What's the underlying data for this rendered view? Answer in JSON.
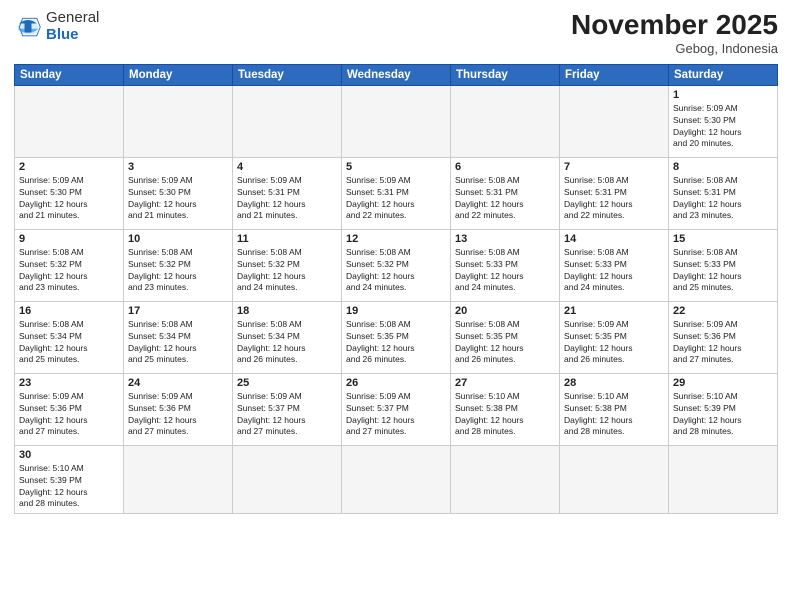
{
  "header": {
    "logo_general": "General",
    "logo_blue": "Blue",
    "month_title": "November 2025",
    "subtitle": "Gebog, Indonesia"
  },
  "weekdays": [
    "Sunday",
    "Monday",
    "Tuesday",
    "Wednesday",
    "Thursday",
    "Friday",
    "Saturday"
  ],
  "weeks": [
    [
      {
        "day": "",
        "info": ""
      },
      {
        "day": "",
        "info": ""
      },
      {
        "day": "",
        "info": ""
      },
      {
        "day": "",
        "info": ""
      },
      {
        "day": "",
        "info": ""
      },
      {
        "day": "",
        "info": ""
      },
      {
        "day": "1",
        "info": "Sunrise: 5:09 AM\nSunset: 5:30 PM\nDaylight: 12 hours\nand 20 minutes."
      }
    ],
    [
      {
        "day": "2",
        "info": "Sunrise: 5:09 AM\nSunset: 5:30 PM\nDaylight: 12 hours\nand 21 minutes."
      },
      {
        "day": "3",
        "info": "Sunrise: 5:09 AM\nSunset: 5:30 PM\nDaylight: 12 hours\nand 21 minutes."
      },
      {
        "day": "4",
        "info": "Sunrise: 5:09 AM\nSunset: 5:31 PM\nDaylight: 12 hours\nand 21 minutes."
      },
      {
        "day": "5",
        "info": "Sunrise: 5:09 AM\nSunset: 5:31 PM\nDaylight: 12 hours\nand 22 minutes."
      },
      {
        "day": "6",
        "info": "Sunrise: 5:08 AM\nSunset: 5:31 PM\nDaylight: 12 hours\nand 22 minutes."
      },
      {
        "day": "7",
        "info": "Sunrise: 5:08 AM\nSunset: 5:31 PM\nDaylight: 12 hours\nand 22 minutes."
      },
      {
        "day": "8",
        "info": "Sunrise: 5:08 AM\nSunset: 5:31 PM\nDaylight: 12 hours\nand 23 minutes."
      }
    ],
    [
      {
        "day": "9",
        "info": "Sunrise: 5:08 AM\nSunset: 5:32 PM\nDaylight: 12 hours\nand 23 minutes."
      },
      {
        "day": "10",
        "info": "Sunrise: 5:08 AM\nSunset: 5:32 PM\nDaylight: 12 hours\nand 23 minutes."
      },
      {
        "day": "11",
        "info": "Sunrise: 5:08 AM\nSunset: 5:32 PM\nDaylight: 12 hours\nand 24 minutes."
      },
      {
        "day": "12",
        "info": "Sunrise: 5:08 AM\nSunset: 5:32 PM\nDaylight: 12 hours\nand 24 minutes."
      },
      {
        "day": "13",
        "info": "Sunrise: 5:08 AM\nSunset: 5:33 PM\nDaylight: 12 hours\nand 24 minutes."
      },
      {
        "day": "14",
        "info": "Sunrise: 5:08 AM\nSunset: 5:33 PM\nDaylight: 12 hours\nand 24 minutes."
      },
      {
        "day": "15",
        "info": "Sunrise: 5:08 AM\nSunset: 5:33 PM\nDaylight: 12 hours\nand 25 minutes."
      }
    ],
    [
      {
        "day": "16",
        "info": "Sunrise: 5:08 AM\nSunset: 5:34 PM\nDaylight: 12 hours\nand 25 minutes."
      },
      {
        "day": "17",
        "info": "Sunrise: 5:08 AM\nSunset: 5:34 PM\nDaylight: 12 hours\nand 25 minutes."
      },
      {
        "day": "18",
        "info": "Sunrise: 5:08 AM\nSunset: 5:34 PM\nDaylight: 12 hours\nand 26 minutes."
      },
      {
        "day": "19",
        "info": "Sunrise: 5:08 AM\nSunset: 5:35 PM\nDaylight: 12 hours\nand 26 minutes."
      },
      {
        "day": "20",
        "info": "Sunrise: 5:08 AM\nSunset: 5:35 PM\nDaylight: 12 hours\nand 26 minutes."
      },
      {
        "day": "21",
        "info": "Sunrise: 5:09 AM\nSunset: 5:35 PM\nDaylight: 12 hours\nand 26 minutes."
      },
      {
        "day": "22",
        "info": "Sunrise: 5:09 AM\nSunset: 5:36 PM\nDaylight: 12 hours\nand 27 minutes."
      }
    ],
    [
      {
        "day": "23",
        "info": "Sunrise: 5:09 AM\nSunset: 5:36 PM\nDaylight: 12 hours\nand 27 minutes."
      },
      {
        "day": "24",
        "info": "Sunrise: 5:09 AM\nSunset: 5:36 PM\nDaylight: 12 hours\nand 27 minutes."
      },
      {
        "day": "25",
        "info": "Sunrise: 5:09 AM\nSunset: 5:37 PM\nDaylight: 12 hours\nand 27 minutes."
      },
      {
        "day": "26",
        "info": "Sunrise: 5:09 AM\nSunset: 5:37 PM\nDaylight: 12 hours\nand 27 minutes."
      },
      {
        "day": "27",
        "info": "Sunrise: 5:10 AM\nSunset: 5:38 PM\nDaylight: 12 hours\nand 28 minutes."
      },
      {
        "day": "28",
        "info": "Sunrise: 5:10 AM\nSunset: 5:38 PM\nDaylight: 12 hours\nand 28 minutes."
      },
      {
        "day": "29",
        "info": "Sunrise: 5:10 AM\nSunset: 5:39 PM\nDaylight: 12 hours\nand 28 minutes."
      }
    ],
    [
      {
        "day": "30",
        "info": "Sunrise: 5:10 AM\nSunset: 5:39 PM\nDaylight: 12 hours\nand 28 minutes."
      },
      {
        "day": "",
        "info": ""
      },
      {
        "day": "",
        "info": ""
      },
      {
        "day": "",
        "info": ""
      },
      {
        "day": "",
        "info": ""
      },
      {
        "day": "",
        "info": ""
      },
      {
        "day": "",
        "info": ""
      }
    ]
  ]
}
